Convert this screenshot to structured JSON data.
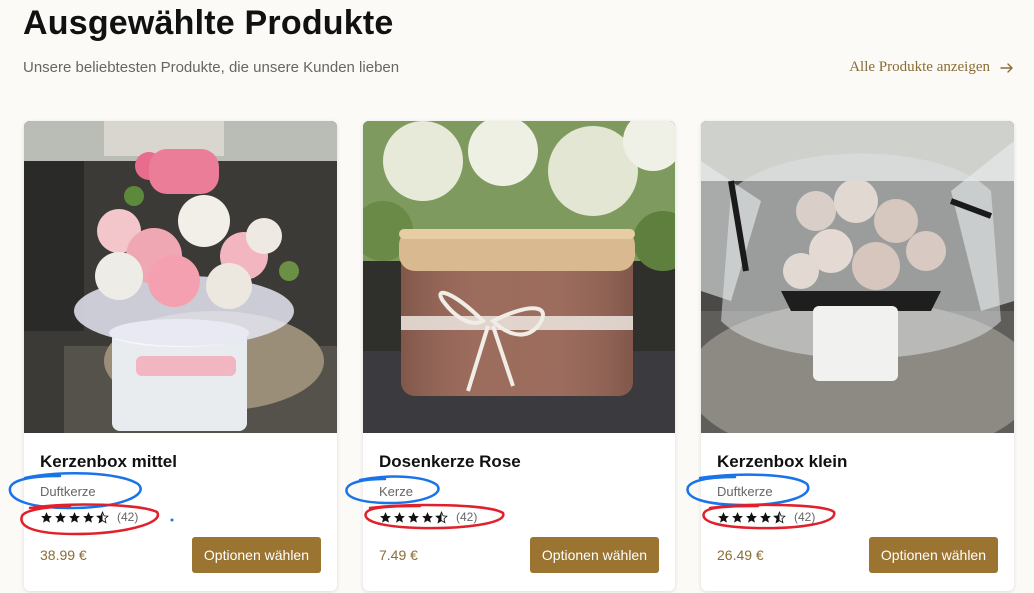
{
  "header": {
    "title": "Ausgewählte Produkte",
    "subtitle": "Unsere beliebtesten Produkte, die unsere Kunden lieben",
    "all_products_link": "Alle Produkte anzeigen",
    "link_icon": "arrow-right-icon"
  },
  "colors": {
    "accent": "#9a7430",
    "price": "#8a6d35",
    "annotation_blue": "#1a73e8",
    "annotation_red": "#e0202a"
  },
  "products": [
    {
      "name": "Kerzenbox mittel",
      "category": "Duftkerze",
      "rating": 4.5,
      "review_count": "(42)",
      "price": "38.99 €",
      "button_label": "Optionen wählen",
      "image": "candle-box-bouquet-photo"
    },
    {
      "name": "Dosenkerze Rose",
      "category": "Kerze",
      "rating": 4.5,
      "review_count": "(42)",
      "price": "7.49 €",
      "button_label": "Optionen wählen",
      "image": "tin-candle-photo"
    },
    {
      "name": "Kerzenbox klein",
      "category": "Duftkerze",
      "rating": 4.5,
      "review_count": "(42)",
      "price": "26.49 €",
      "button_label": "Optionen wählen",
      "image": "wrapped-candle-bouquet-photo"
    }
  ]
}
